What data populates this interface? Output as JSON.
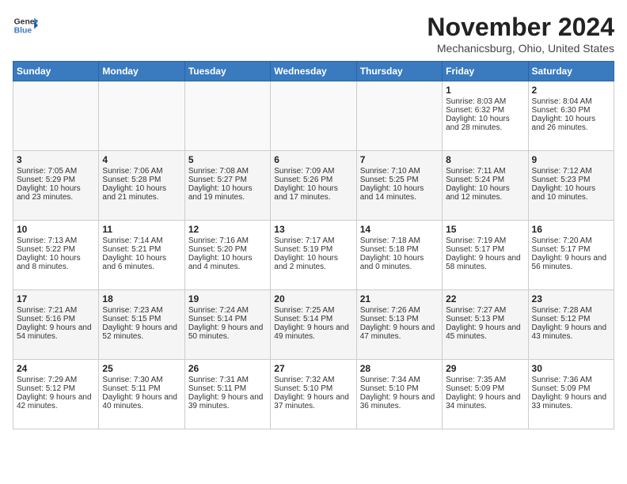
{
  "header": {
    "logo_general": "General",
    "logo_blue": "Blue",
    "month_title": "November 2024",
    "location": "Mechanicsburg, Ohio, United States"
  },
  "weekdays": [
    "Sunday",
    "Monday",
    "Tuesday",
    "Wednesday",
    "Thursday",
    "Friday",
    "Saturday"
  ],
  "weeks": [
    [
      {
        "day": "",
        "empty": true
      },
      {
        "day": "",
        "empty": true
      },
      {
        "day": "",
        "empty": true
      },
      {
        "day": "",
        "empty": true
      },
      {
        "day": "",
        "empty": true
      },
      {
        "day": "1",
        "sunrise": "Sunrise: 8:03 AM",
        "sunset": "Sunset: 6:32 PM",
        "daylight": "Daylight: 10 hours and 28 minutes."
      },
      {
        "day": "2",
        "sunrise": "Sunrise: 8:04 AM",
        "sunset": "Sunset: 6:30 PM",
        "daylight": "Daylight: 10 hours and 26 minutes."
      }
    ],
    [
      {
        "day": "3",
        "sunrise": "Sunrise: 7:05 AM",
        "sunset": "Sunset: 5:29 PM",
        "daylight": "Daylight: 10 hours and 23 minutes."
      },
      {
        "day": "4",
        "sunrise": "Sunrise: 7:06 AM",
        "sunset": "Sunset: 5:28 PM",
        "daylight": "Daylight: 10 hours and 21 minutes."
      },
      {
        "day": "5",
        "sunrise": "Sunrise: 7:08 AM",
        "sunset": "Sunset: 5:27 PM",
        "daylight": "Daylight: 10 hours and 19 minutes."
      },
      {
        "day": "6",
        "sunrise": "Sunrise: 7:09 AM",
        "sunset": "Sunset: 5:26 PM",
        "daylight": "Daylight: 10 hours and 17 minutes."
      },
      {
        "day": "7",
        "sunrise": "Sunrise: 7:10 AM",
        "sunset": "Sunset: 5:25 PM",
        "daylight": "Daylight: 10 hours and 14 minutes."
      },
      {
        "day": "8",
        "sunrise": "Sunrise: 7:11 AM",
        "sunset": "Sunset: 5:24 PM",
        "daylight": "Daylight: 10 hours and 12 minutes."
      },
      {
        "day": "9",
        "sunrise": "Sunrise: 7:12 AM",
        "sunset": "Sunset: 5:23 PM",
        "daylight": "Daylight: 10 hours and 10 minutes."
      }
    ],
    [
      {
        "day": "10",
        "sunrise": "Sunrise: 7:13 AM",
        "sunset": "Sunset: 5:22 PM",
        "daylight": "Daylight: 10 hours and 8 minutes."
      },
      {
        "day": "11",
        "sunrise": "Sunrise: 7:14 AM",
        "sunset": "Sunset: 5:21 PM",
        "daylight": "Daylight: 10 hours and 6 minutes."
      },
      {
        "day": "12",
        "sunrise": "Sunrise: 7:16 AM",
        "sunset": "Sunset: 5:20 PM",
        "daylight": "Daylight: 10 hours and 4 minutes."
      },
      {
        "day": "13",
        "sunrise": "Sunrise: 7:17 AM",
        "sunset": "Sunset: 5:19 PM",
        "daylight": "Daylight: 10 hours and 2 minutes."
      },
      {
        "day": "14",
        "sunrise": "Sunrise: 7:18 AM",
        "sunset": "Sunset: 5:18 PM",
        "daylight": "Daylight: 10 hours and 0 minutes."
      },
      {
        "day": "15",
        "sunrise": "Sunrise: 7:19 AM",
        "sunset": "Sunset: 5:17 PM",
        "daylight": "Daylight: 9 hours and 58 minutes."
      },
      {
        "day": "16",
        "sunrise": "Sunrise: 7:20 AM",
        "sunset": "Sunset: 5:17 PM",
        "daylight": "Daylight: 9 hours and 56 minutes."
      }
    ],
    [
      {
        "day": "17",
        "sunrise": "Sunrise: 7:21 AM",
        "sunset": "Sunset: 5:16 PM",
        "daylight": "Daylight: 9 hours and 54 minutes."
      },
      {
        "day": "18",
        "sunrise": "Sunrise: 7:23 AM",
        "sunset": "Sunset: 5:15 PM",
        "daylight": "Daylight: 9 hours and 52 minutes."
      },
      {
        "day": "19",
        "sunrise": "Sunrise: 7:24 AM",
        "sunset": "Sunset: 5:14 PM",
        "daylight": "Daylight: 9 hours and 50 minutes."
      },
      {
        "day": "20",
        "sunrise": "Sunrise: 7:25 AM",
        "sunset": "Sunset: 5:14 PM",
        "daylight": "Daylight: 9 hours and 49 minutes."
      },
      {
        "day": "21",
        "sunrise": "Sunrise: 7:26 AM",
        "sunset": "Sunset: 5:13 PM",
        "daylight": "Daylight: 9 hours and 47 minutes."
      },
      {
        "day": "22",
        "sunrise": "Sunrise: 7:27 AM",
        "sunset": "Sunset: 5:13 PM",
        "daylight": "Daylight: 9 hours and 45 minutes."
      },
      {
        "day": "23",
        "sunrise": "Sunrise: 7:28 AM",
        "sunset": "Sunset: 5:12 PM",
        "daylight": "Daylight: 9 hours and 43 minutes."
      }
    ],
    [
      {
        "day": "24",
        "sunrise": "Sunrise: 7:29 AM",
        "sunset": "Sunset: 5:12 PM",
        "daylight": "Daylight: 9 hours and 42 minutes."
      },
      {
        "day": "25",
        "sunrise": "Sunrise: 7:30 AM",
        "sunset": "Sunset: 5:11 PM",
        "daylight": "Daylight: 9 hours and 40 minutes."
      },
      {
        "day": "26",
        "sunrise": "Sunrise: 7:31 AM",
        "sunset": "Sunset: 5:11 PM",
        "daylight": "Daylight: 9 hours and 39 minutes."
      },
      {
        "day": "27",
        "sunrise": "Sunrise: 7:32 AM",
        "sunset": "Sunset: 5:10 PM",
        "daylight": "Daylight: 9 hours and 37 minutes."
      },
      {
        "day": "28",
        "sunrise": "Sunrise: 7:34 AM",
        "sunset": "Sunset: 5:10 PM",
        "daylight": "Daylight: 9 hours and 36 minutes."
      },
      {
        "day": "29",
        "sunrise": "Sunrise: 7:35 AM",
        "sunset": "Sunset: 5:09 PM",
        "daylight": "Daylight: 9 hours and 34 minutes."
      },
      {
        "day": "30",
        "sunrise": "Sunrise: 7:36 AM",
        "sunset": "Sunset: 5:09 PM",
        "daylight": "Daylight: 9 hours and 33 minutes."
      }
    ]
  ]
}
